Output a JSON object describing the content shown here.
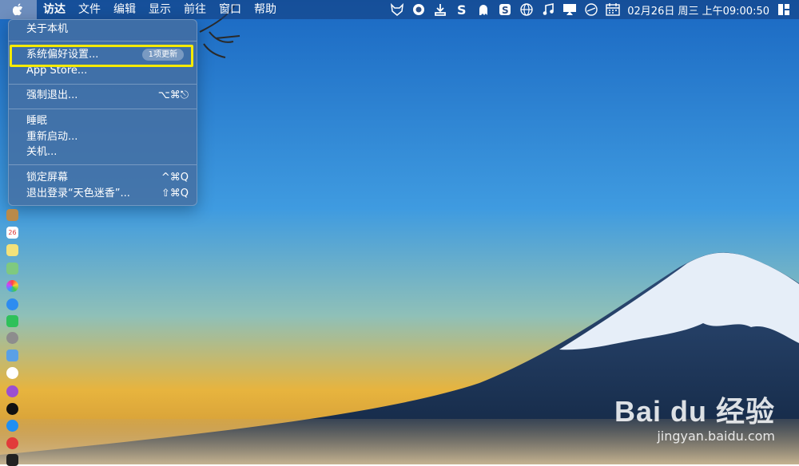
{
  "menubar": {
    "apple": "",
    "items": [
      "访达",
      "文件",
      "编辑",
      "显示",
      "前往",
      "窗口",
      "帮助"
    ],
    "clock": "02月26日 周三 上午09:00:50",
    "status_icons": [
      "firefox-fox-icon",
      "record-icon",
      "download-icon",
      "s-app-icon",
      "ghost-icon",
      "sogou-input-icon",
      "globe-icon",
      "music-note-icon",
      "airplay-icon",
      "clock-sync-icon",
      "calendar-icon",
      "grid-icon"
    ]
  },
  "apple_menu": {
    "about": "关于本机",
    "system_prefs": "系统偏好设置...",
    "system_prefs_badge": "1项更新",
    "app_store": "App Store...",
    "force_quit": "强制退出...",
    "force_quit_shortcut": "⌥⌘⎋",
    "sleep": "睡眠",
    "restart": "重新启动...",
    "shutdown": "关机...",
    "lock_screen": "锁定屏幕",
    "lock_screen_shortcut": "^⌘Q",
    "logout": "退出登录“天色迷香”...",
    "logout_shortcut": "⇧⌘Q"
  },
  "dock": {
    "calendar_day": "26",
    "items": [
      "contacts-icon",
      "calendar-icon",
      "notes-icon",
      "maps-icon",
      "photos-icon",
      "messages-icon",
      "wechat-icon",
      "preferences-icon",
      "keynote-icon",
      "music-icon",
      "podcasts-icon",
      "appletv-icon",
      "appstore-icon",
      "vivaldi-icon",
      "terminal-icon"
    ]
  },
  "watermark": {
    "logo": "Bai du 经验",
    "url": "jingyan.baidu.com"
  },
  "colors": {
    "highlight": "#f5ea00",
    "sky_top": "#1d6ec4",
    "sky_bottom": "#f0b53a"
  }
}
